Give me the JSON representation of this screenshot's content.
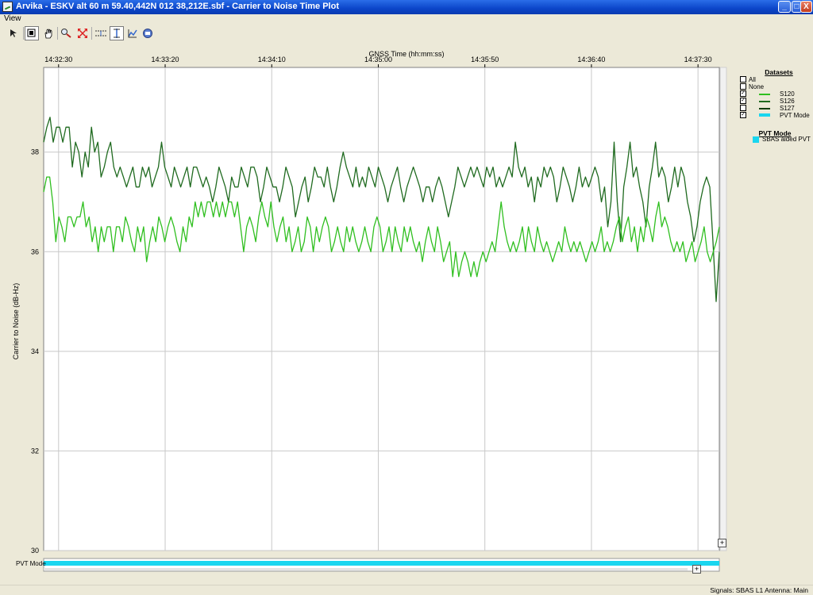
{
  "window": {
    "title": "Arvika - ESKV alt 60 m 59.40,442N 012 38,212E.sbf - Carrier to Noise Time Plot",
    "min_label": "_",
    "max_label": "□",
    "close_label": "X"
  },
  "menu": {
    "view": "View"
  },
  "toolbar": {
    "icons": [
      "cursor-icon",
      "zoom-box-icon",
      "hand-pan-icon",
      "zoom-magnify-icon",
      "zoom-extent-icon",
      "hline-icon",
      "vline-icon",
      "reset-icon",
      "print-icon"
    ]
  },
  "legend": {
    "datasets_title": "Datasets",
    "items": [
      {
        "label": "All",
        "checked": false,
        "color": ""
      },
      {
        "label": "None",
        "checked": false,
        "color": ""
      },
      {
        "label": "S120",
        "checked": true,
        "color": "#2fbf1f"
      },
      {
        "label": "S126",
        "checked": true,
        "color": "#1f6a1f"
      },
      {
        "label": "S127",
        "checked": false,
        "color": "#0b3d0b"
      },
      {
        "label": "PVT Mode",
        "checked": true,
        "color": "#1ad6ef"
      }
    ],
    "pvt_title": "PVT Mode",
    "pvt_item": "SBAS aided PVT",
    "pvt_color": "#1ad6ef"
  },
  "status": {
    "text": "Signals: SBAS L1   Antenna: Main"
  },
  "pvt_axis_label": "PVT Mode",
  "chart_data": {
    "type": "line",
    "xlabel": "GNSS Time (hh:mm:ss)",
    "ylabel": "Carrier to Noise (dB-Hz)",
    "x_ticks": [
      "14:32:30",
      "14:33:20",
      "14:34:10",
      "14:35:00",
      "14:35:50",
      "14:36:40",
      "14:37:30"
    ],
    "x_range_seconds": [
      0,
      317
    ],
    "y_ticks": [
      30,
      32,
      34,
      36,
      38
    ],
    "ylim": [
      30,
      39.7
    ],
    "grid": true,
    "series": [
      {
        "name": "S126",
        "color": "#1f6a1f",
        "values": [
          38.2,
          38.5,
          38.7,
          38.2,
          38.5,
          38.5,
          38.2,
          38.5,
          38.5,
          37.7,
          38.2,
          38.0,
          37.5,
          38.0,
          37.7,
          38.5,
          38.0,
          38.2,
          37.5,
          37.7,
          38.0,
          38.2,
          37.7,
          37.5,
          37.7,
          37.5,
          37.3,
          37.5,
          37.7,
          37.3,
          37.3,
          37.7,
          37.5,
          37.7,
          37.3,
          37.5,
          37.7,
          38.2,
          37.7,
          37.5,
          37.3,
          37.7,
          37.5,
          37.3,
          37.5,
          37.7,
          37.3,
          37.7,
          37.7,
          37.5,
          37.3,
          37.5,
          37.3,
          37.0,
          37.3,
          37.7,
          37.5,
          37.3,
          37.0,
          37.5,
          37.3,
          37.3,
          37.7,
          37.5,
          37.3,
          37.7,
          37.7,
          37.5,
          37.0,
          37.3,
          37.7,
          37.5,
          37.3,
          37.3,
          37.0,
          37.3,
          37.7,
          37.5,
          37.3,
          36.7,
          37.0,
          37.3,
          37.5,
          37.0,
          37.3,
          37.7,
          37.5,
          37.5,
          37.3,
          37.7,
          37.3,
          37.0,
          37.3,
          37.7,
          38.0,
          37.7,
          37.5,
          37.3,
          37.7,
          37.3,
          37.5,
          37.3,
          37.7,
          37.5,
          37.3,
          37.7,
          37.5,
          37.3,
          37.0,
          37.3,
          37.5,
          37.7,
          37.3,
          37.0,
          37.3,
          37.5,
          37.7,
          37.5,
          37.3,
          37.0,
          37.3,
          37.3,
          37.0,
          37.3,
          37.5,
          37.3,
          37.0,
          36.7,
          37.0,
          37.3,
          37.7,
          37.5,
          37.3,
          37.5,
          37.7,
          37.5,
          37.7,
          37.5,
          37.3,
          37.7,
          37.5,
          37.7,
          37.3,
          37.5,
          37.3,
          37.5,
          37.7,
          37.5,
          38.2,
          37.7,
          37.5,
          37.7,
          37.3,
          37.5,
          37.0,
          37.5,
          37.3,
          37.7,
          37.5,
          37.7,
          37.5,
          37.0,
          37.3,
          37.7,
          37.5,
          37.3,
          37.0,
          37.3,
          37.7,
          37.3,
          37.5,
          37.3,
          37.5,
          37.7,
          37.5,
          37.0,
          37.3,
          36.5,
          37.0,
          38.2,
          37.0,
          36.2,
          37.3,
          37.7,
          38.2,
          37.5,
          37.7,
          37.3,
          37.0,
          36.5,
          37.3,
          37.7,
          38.2,
          37.5,
          37.7,
          37.5,
          37.0,
          37.3,
          37.7,
          37.3,
          37.7,
          37.5,
          37.0,
          36.7,
          36.2,
          36.5,
          37.0,
          37.3,
          37.5,
          37.3,
          36.2,
          35.0,
          36.0
        ]
      },
      {
        "name": "S120",
        "color": "#2fbf1f",
        "values": [
          37.2,
          37.5,
          37.5,
          37.0,
          36.2,
          36.7,
          36.5,
          36.2,
          36.7,
          36.7,
          36.5,
          36.7,
          36.7,
          37.0,
          36.5,
          36.7,
          36.2,
          36.5,
          36.0,
          36.5,
          36.2,
          36.5,
          36.5,
          36.0,
          36.5,
          36.5,
          36.2,
          36.7,
          36.5,
          36.2,
          36.0,
          36.5,
          36.2,
          36.5,
          35.8,
          36.2,
          36.5,
          36.2,
          36.7,
          36.5,
          36.2,
          36.5,
          36.7,
          36.5,
          36.2,
          36.0,
          36.5,
          36.2,
          36.7,
          36.5,
          37.0,
          36.7,
          37.0,
          36.7,
          37.0,
          37.0,
          36.7,
          37.0,
          36.7,
          37.0,
          36.7,
          37.0,
          37.0,
          36.7,
          37.0,
          36.5,
          36.0,
          36.5,
          36.7,
          36.5,
          36.2,
          36.7,
          37.0,
          36.7,
          36.5,
          37.0,
          36.5,
          36.2,
          36.5,
          36.7,
          36.2,
          36.5,
          36.0,
          36.2,
          36.5,
          36.0,
          36.2,
          36.7,
          36.5,
          36.0,
          36.5,
          36.2,
          36.5,
          36.7,
          36.5,
          36.0,
          36.2,
          36.5,
          36.2,
          36.0,
          36.5,
          36.2,
          36.5,
          36.2,
          36.0,
          36.2,
          36.5,
          36.2,
          36.0,
          36.5,
          36.7,
          36.5,
          36.0,
          36.2,
          36.5,
          36.0,
          36.5,
          36.2,
          36.0,
          36.5,
          36.2,
          36.5,
          36.2,
          36.0,
          36.2,
          35.8,
          36.2,
          36.5,
          36.2,
          36.0,
          36.5,
          36.2,
          35.8,
          36.0,
          36.2,
          35.5,
          36.0,
          35.5,
          35.8,
          36.0,
          35.8,
          35.5,
          35.8,
          35.5,
          35.8,
          36.0,
          35.8,
          36.0,
          36.2,
          36.0,
          36.5,
          37.0,
          36.5,
          36.2,
          36.0,
          36.2,
          36.0,
          36.2,
          36.5,
          36.0,
          36.5,
          36.2,
          36.0,
          36.5,
          36.2,
          36.0,
          36.2,
          36.0,
          35.8,
          36.0,
          36.2,
          36.0,
          36.5,
          36.2,
          36.0,
          36.2,
          36.0,
          36.2,
          36.0,
          35.8,
          36.0,
          36.2,
          36.0,
          36.2,
          36.5,
          36.0,
          36.2,
          36.0,
          36.2,
          36.5,
          36.7,
          36.2,
          36.5,
          36.7,
          36.2,
          36.5,
          36.0,
          36.5,
          36.2,
          36.7,
          36.5,
          36.2,
          36.7,
          37.0,
          36.5,
          36.7,
          36.5,
          36.2,
          36.0,
          36.2,
          36.0,
          36.2,
          35.8,
          36.0,
          36.2,
          35.8,
          36.0,
          36.2,
          36.5,
          36.0,
          35.8,
          36.0,
          36.2,
          36.5
        ]
      }
    ],
    "pvt_mode": {
      "label": "SBAS aided PVT",
      "color": "#1ad6ef"
    }
  }
}
